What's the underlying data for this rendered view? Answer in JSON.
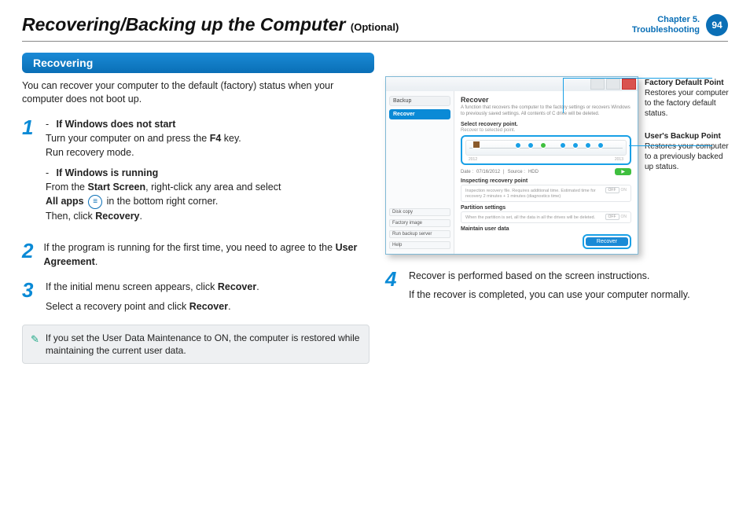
{
  "header": {
    "title": "Recovering/Backing up the Computer",
    "optional": "(Optional)",
    "chapter_line1": "Chapter 5.",
    "chapter_line2": "Troubleshooting",
    "page": "94"
  },
  "left": {
    "section": "Recovering",
    "intro": "You can recover your computer to the default (factory) status when your computer does not boot up.",
    "step1": {
      "n": "1",
      "a_title": "If Windows does not start",
      "a_l1_pre": "Turn your computer on and press the ",
      "a_l1_key": "F4",
      "a_l1_post": " key.",
      "a_l2": "Run recovery mode.",
      "b_title": "If Windows is running",
      "b_l1_pre": "From the ",
      "b_l1_b1": "Start Screen",
      "b_l1_mid": ", right-click any area and select ",
      "b_l2_b": "All apps",
      "b_l2_post": " in the bottom right corner.",
      "b_l3_pre": "Then, click ",
      "b_l3_b": "Recovery",
      "b_l3_post": "."
    },
    "step2": {
      "n": "2",
      "t_pre": "If the program is running for the first time, you need to agree to the ",
      "t_b": "User Agreement",
      "t_post": "."
    },
    "step3": {
      "n": "3",
      "l1_pre": "If the initial menu screen appears, click ",
      "l1_b": "Recover",
      "l1_post": ".",
      "l2_pre": "Select a recovery point and click ",
      "l2_b": "Recover",
      "l2_post": "."
    },
    "note": "If you set the User Data Maintenance to ON, the computer is restored while maintaining the current user data."
  },
  "screenshot": {
    "nav": {
      "backup": "Backup",
      "recover": "Recover",
      "diskcopy": "Disk copy",
      "factory": "Factory image",
      "runbk": "Run backup server",
      "help": "Help"
    },
    "main": {
      "title": "Recover",
      "desc": "A function that recovers the computer to the factory settings or recovers Windows to previously saved settings. All contents of C drive will be deleted.",
      "sec1": "Select recovery point.",
      "sec1_sub": "Recover to selected point.",
      "year_a": "2012",
      "year_b": "2013",
      "date_label": "Date : ",
      "date": "07/16/2012",
      "src_label": "Source : ",
      "src": "HDD",
      "sec2": "Inspecting recovery point",
      "sec2_line": "Inspection recovery file. Requires additional time. Estimated time for recovery 2 minutes + 1 minutes (diagnostics time)",
      "sec3": "Partition settings",
      "sec3_line": "When the partition is set, all the data in all the drives will be deleted.",
      "sec4": "Maintain user data",
      "off": "OFF",
      "on": "ON",
      "btn": "Recover"
    }
  },
  "callouts": {
    "c1_t": "Factory Default Point",
    "c1_b": "Restores your computer to the factory default status.",
    "c2_t": "User's Backup Point",
    "c2_b": "Restores your computer to a previously backed up status."
  },
  "step4": {
    "n": "4",
    "l1": "Recover is performed based on the screen instructions.",
    "l2": "If the recover is completed, you can use your computer normally."
  }
}
